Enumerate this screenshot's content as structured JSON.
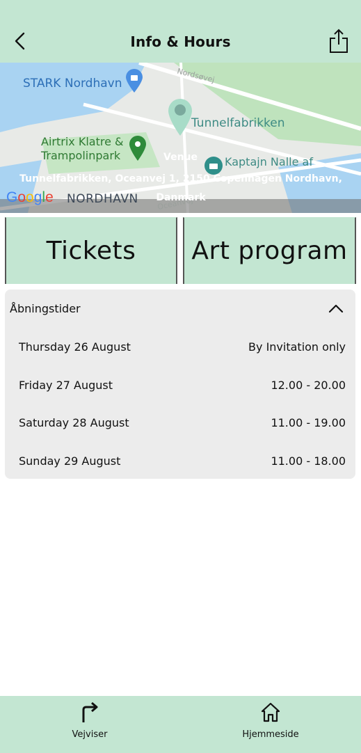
{
  "header": {
    "title": "Info & Hours",
    "back_icon": "chevron-left-icon",
    "share_icon": "share-icon"
  },
  "map": {
    "places": {
      "stark": "STARK Nordhavn",
      "tunnel": "Tunnelfabrikken",
      "airtrix_line1": "Airtrix Klatre &",
      "airtrix_line2": "Trampolinpark",
      "kaptajn": "Kaptajn Nalle af"
    },
    "streets": {
      "nordsovej": "Nordsøvej",
      "oceanvej": "Oceanvej"
    },
    "area_label": "NORDHAVN",
    "google_logo": "Google",
    "venue_label": "Venue",
    "venue_address": "Tunnelfabrikken, Oceanvej 1, 2150 Copenhagen Nordhavn, Danmark"
  },
  "tabs": {
    "tickets": "Tickets",
    "art_program": "Art program"
  },
  "hours": {
    "title": "Åbningstider",
    "rows": [
      {
        "day": "Thursday 26 August",
        "time": "By Invitation only"
      },
      {
        "day": "Friday 27 August",
        "time": "12.00 - 20.00"
      },
      {
        "day": "Saturday 28 August",
        "time": "11.00 - 19.00"
      },
      {
        "day": "Sunday 29 August",
        "time": "11.00 - 18.00"
      }
    ]
  },
  "bottom_nav": {
    "directions": "Vejviser",
    "home": "Hjemmeside"
  },
  "colors": {
    "accent": "#c3e6d2",
    "panel": "#ececec"
  }
}
